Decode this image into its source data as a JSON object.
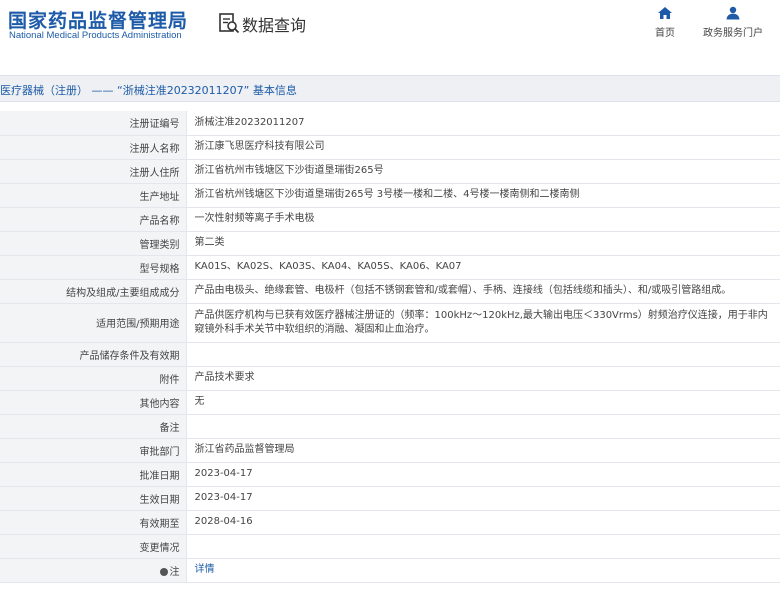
{
  "header": {
    "logo_cn": "国家药品监督管理局",
    "logo_en": "National Medical Products Administration",
    "query_title": "数据查询",
    "nav": [
      {
        "label": "首页",
        "icon": "home-icon"
      },
      {
        "label": "政务服务门户",
        "icon": "user-icon"
      }
    ]
  },
  "breadcrumb": "医疗器械（注册） —— “浙械注准20232011207” 基本信息",
  "colors": {
    "brand": "#1d5ba8",
    "label_bg": "#f3f4f6",
    "border": "#e3e6ea",
    "breadcrumb_bg": "#eef0f4"
  },
  "fields": [
    {
      "label": "注册证编号",
      "value": "浙械注准20232011207"
    },
    {
      "label": "注册人名称",
      "value": "浙江康飞思医疗科技有限公司"
    },
    {
      "label": "注册人住所",
      "value": "浙江省杭州市钱塘区下沙街道垦瑞街265号"
    },
    {
      "label": "生产地址",
      "value": "浙江省杭州钱塘区下沙街道垦瑞街265号 3号楼一楼和二楼、4号楼一楼南侧和二楼南侧"
    },
    {
      "label": "产品名称",
      "value": "一次性射频等离子手术电极"
    },
    {
      "label": "管理类别",
      "value": "第二类"
    },
    {
      "label": "型号规格",
      "value": "KA01S、KA02S、KA03S、KA04、KA05S、KA06、KA07"
    },
    {
      "label": "结构及组成/主要组成成分",
      "value": "产品由电极头、绝缘套管、电极杆（包括不锈钢套管和/或套帽）、手柄、连接线（包括线缆和插头）、和/或吸引管路组成。"
    },
    {
      "label": "适用范围/预期用途",
      "value": "产品供医疗机构与已获有效医疗器械注册证的（频率：100kHz～120kHz,最大输出电压＜330Vrms）射频治疗仪连接，用于非内窥镜外科手术关节中软组织的消融、凝固和止血治疗。"
    },
    {
      "label": "产品储存条件及有效期",
      "value": ""
    },
    {
      "label": "附件",
      "value": "产品技术要求"
    },
    {
      "label": "其他内容",
      "value": "无"
    },
    {
      "label": "备注",
      "value": ""
    },
    {
      "label": "审批部门",
      "value": "浙江省药品监督管理局"
    },
    {
      "label": "批准日期",
      "value": "2023-04-17"
    },
    {
      "label": "生效日期",
      "value": "2023-04-17"
    },
    {
      "label": "有效期至",
      "value": "2028-04-16"
    },
    {
      "label": "变更情况",
      "value": ""
    }
  ],
  "note": {
    "label": "注",
    "link": "详情"
  }
}
